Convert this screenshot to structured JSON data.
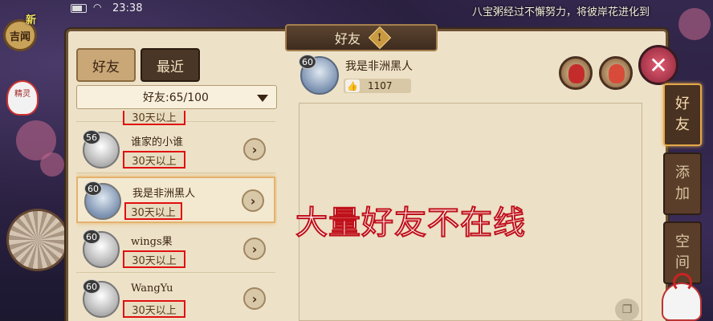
{
  "statusbar": {
    "time": "23:38",
    "wifi_icon": "wifi-icon",
    "battery_icon": "battery-icon"
  },
  "ticker": {
    "text": "八宝粥经过不懈努力，将彼岸花进化到"
  },
  "topleft": {
    "menu_label": "吉闻",
    "new_badge": "新",
    "sprite_label": "精灵"
  },
  "header": {
    "title": "好友",
    "warning_glyph": "!"
  },
  "tabs": [
    {
      "label": "好友",
      "active": true
    },
    {
      "label": "最近",
      "active": false
    }
  ],
  "filter": {
    "label": "好友:65/100"
  },
  "friends": [
    {
      "level": "",
      "name": "",
      "status": "30天以上",
      "selected": false
    },
    {
      "level": "56",
      "name": "谁家的小谁",
      "status": "30天以上",
      "selected": false
    },
    {
      "level": "60",
      "name": "我是非洲黑人",
      "status": "30天以上",
      "selected": true
    },
    {
      "level": "60",
      "name": "wings果",
      "status": "30天以上",
      "selected": false
    },
    {
      "level": "60",
      "name": "WangYu",
      "status": "30天以上",
      "selected": false
    }
  ],
  "detail": {
    "level": "60",
    "name": "我是非洲黑人",
    "likes": "1107"
  },
  "overlay_text": "大量好友不在线",
  "side_nav": [
    {
      "label_top": "好",
      "label_bottom": "友",
      "active": true
    },
    {
      "label_top": "添",
      "label_bottom": "加",
      "active": false
    },
    {
      "label_top": "空",
      "label_bottom": "间",
      "active": false
    }
  ],
  "colors": {
    "status_border": "#e01010",
    "panel_bg": "#ede2c8",
    "frame": "#6e5236",
    "overlay_stroke": "#c0101a"
  }
}
